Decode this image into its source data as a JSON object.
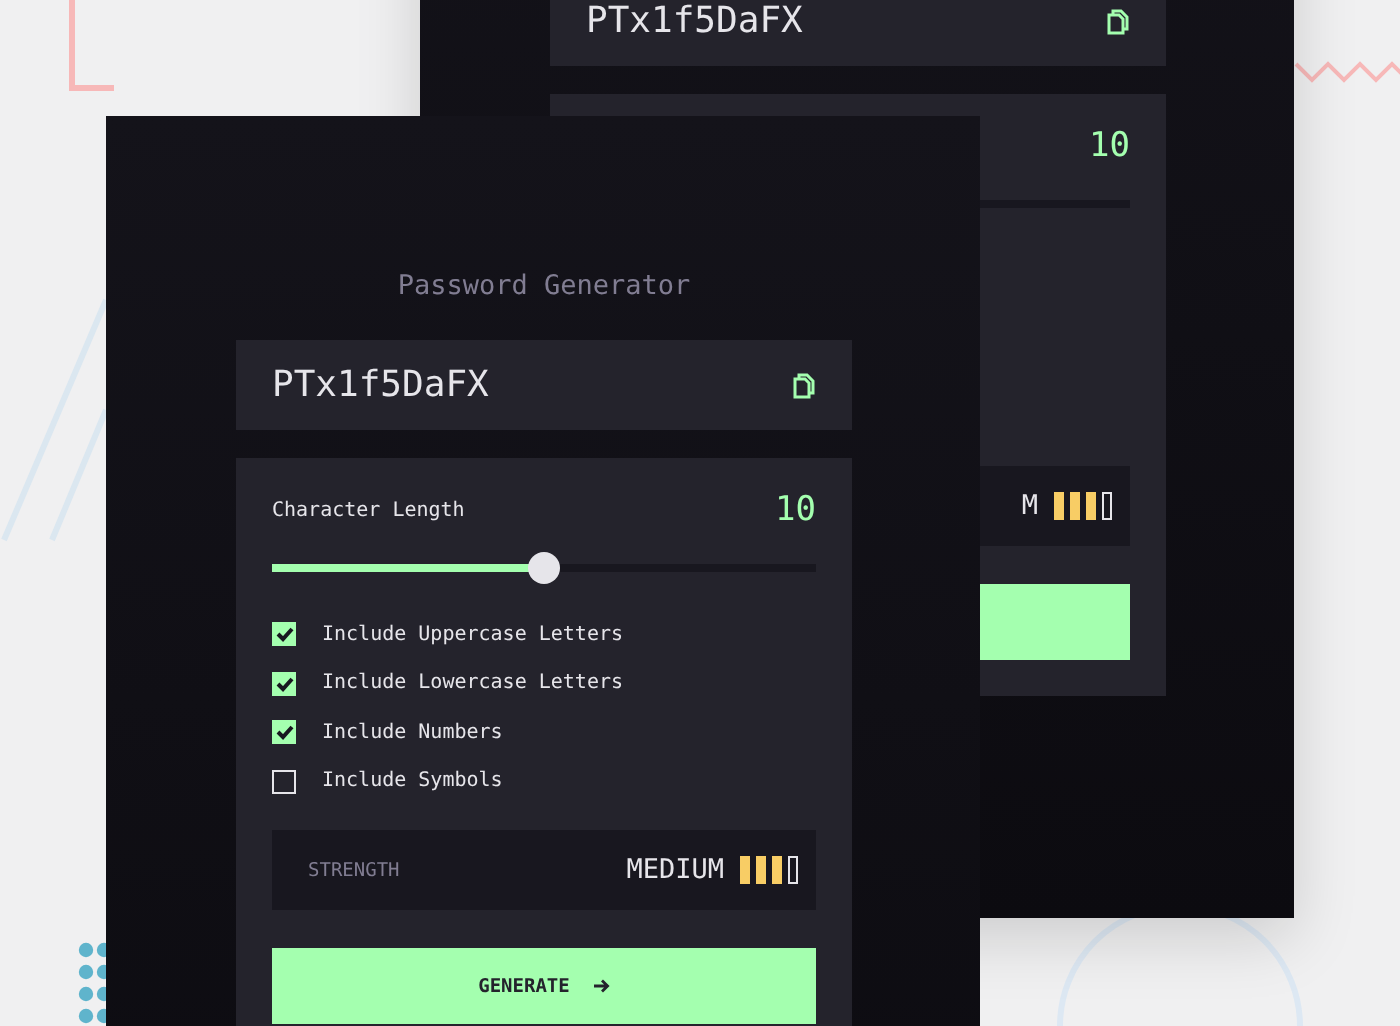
{
  "screens": [
    {
      "password": "PTx1f5DaFX",
      "length": {
        "value": "10"
      },
      "strength": {
        "label": "M",
        "bars": [
          {
            "on": true
          },
          {
            "on": true
          },
          {
            "on": true
          },
          {
            "on": false
          }
        ]
      }
    },
    {
      "title": "Password Generator",
      "password": "PTx1f5DaFX",
      "length": {
        "label": "Character Length",
        "value": "10",
        "level": 0.5
      },
      "options": [
        {
          "label": "Include Uppercase Letters",
          "checked": true
        },
        {
          "label": "Include Lowercase Letters",
          "checked": true
        },
        {
          "label": "Include Numbers",
          "checked": true
        },
        {
          "label": "Include Symbols",
          "checked": false
        }
      ],
      "strength": {
        "caption": "STRENGTH",
        "label": "MEDIUM",
        "bars": [
          {
            "on": true
          },
          {
            "on": true
          },
          {
            "on": true
          },
          {
            "on": false
          }
        ]
      },
      "generate": {
        "label": "GENERATE"
      }
    }
  ]
}
